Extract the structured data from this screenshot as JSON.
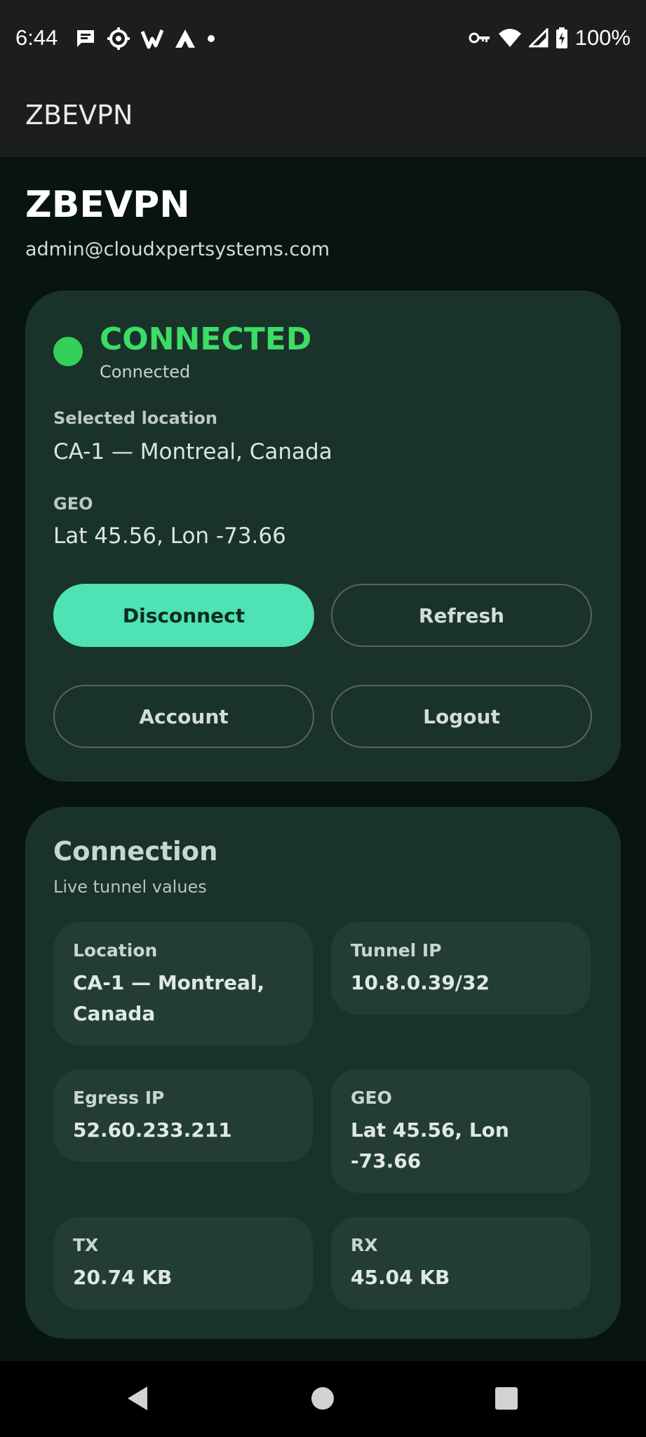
{
  "status_bar": {
    "time": "6:44",
    "battery": "100%",
    "left_icons": [
      "message-icon",
      "settings-gear-icon",
      "vpn-app-icon",
      "triangle-app-icon",
      "dot-icon"
    ],
    "right_icons": [
      "vpn-key-icon",
      "wifi-icon",
      "cell-signal-icon",
      "battery-icon"
    ]
  },
  "app_bar": {
    "title": "ZBEVPN"
  },
  "header": {
    "title": "ZBEVPN",
    "email": "admin@cloudxpertsystems.com"
  },
  "status_card": {
    "headline": "CONNECTED",
    "subtext": "Connected",
    "status_color": "#3ddc67",
    "selected_location_label": "Selected location",
    "selected_location_value": "CA-1 — Montreal, Canada",
    "geo_label": "GEO",
    "geo_value": "Lat 45.56, Lon -73.66",
    "buttons": {
      "disconnect": "Disconnect",
      "refresh": "Refresh",
      "account": "Account",
      "logout": "Logout"
    }
  },
  "connection_card": {
    "title": "Connection",
    "subtitle": "Live tunnel values",
    "tiles": [
      {
        "label": "Location",
        "value": "CA-1 — Montreal, Canada"
      },
      {
        "label": "Tunnel IP",
        "value": "10.8.0.39/32"
      },
      {
        "label": "Egress IP",
        "value": "52.60.233.211"
      },
      {
        "label": "GEO",
        "value": "Lat 45.56, Lon -73.66"
      },
      {
        "label": "TX",
        "value": "20.74 KB"
      },
      {
        "label": "RX",
        "value": "45.04 KB"
      }
    ]
  },
  "nav_bar": {
    "icons": [
      "back-icon",
      "home-icon",
      "recents-icon"
    ]
  },
  "colors": {
    "accent": "#4ee2b4",
    "background": "#081410",
    "card": "#19322a",
    "tile": "#233d34"
  }
}
